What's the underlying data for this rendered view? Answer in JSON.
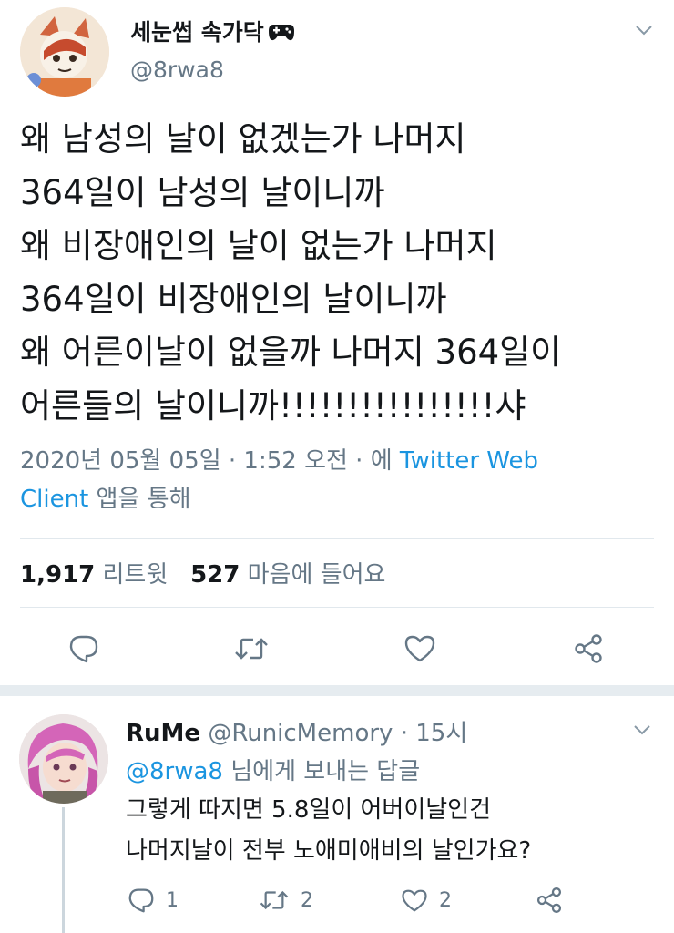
{
  "tweet": {
    "display_name": "세눈썹 속가닥",
    "handle": "@8rwa8",
    "lines": [
      "왜 남성의 날이 없겠는가 나머지",
      "364일이 남성의 날이니까",
      "왜 비장애인의 날이 없는가 나머지",
      "364일이 비장애인의 날이니까",
      "왜 어른이날이 없을까 나머지 364일이",
      "어른들의 날이니까!!!!!!!!!!!!!!!!샤"
    ],
    "timestamp": "2020년 05월 05일 · 1:52 오전 · 에",
    "via_link": "Twitter Web",
    "via_link2": "Client",
    "via_suffix": "앱을 통해",
    "retweet_count": "1,917",
    "retweet_label": "리트윗",
    "like_count": "527",
    "like_label": "마음에 들어요"
  },
  "reply": {
    "name": "RuMe",
    "handle": "@RunicMemory",
    "time": "· 15시",
    "replying_to": "@8rwa8",
    "replying_suffix": "님에게 보내는 답글",
    "lines": [
      "그렇게 따지면 5.8일이 어버이날인건",
      "나머지날이 전부 노애미애비의 날인가요?"
    ],
    "reply_count": "1",
    "retweet_count": "2",
    "like_count": "2"
  },
  "colors": {
    "link": "#1b95e0",
    "secondary": "#657786",
    "text": "#14171a",
    "divider": "#e1e8ed"
  },
  "icons": [
    "gamepad-icon",
    "chevron-down-icon",
    "reply-icon",
    "retweet-icon",
    "like-icon",
    "share-icon"
  ]
}
